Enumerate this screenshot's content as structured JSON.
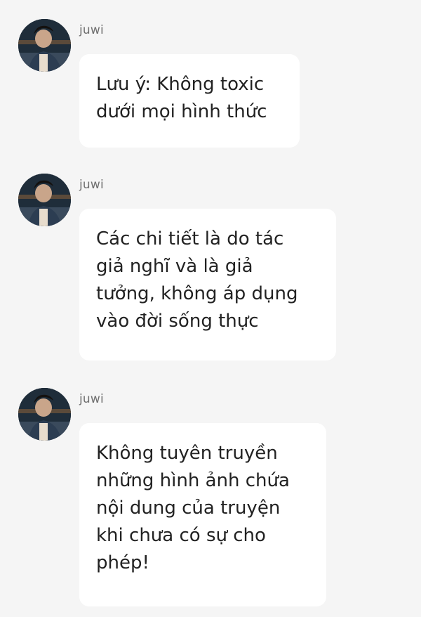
{
  "messages": [
    {
      "author": "juwi",
      "avatar_icon": "user-avatar-photo",
      "lines": [
        "Lưu ý: Không toxic",
        "dưới mọi hình thức"
      ]
    },
    {
      "author": "juwi",
      "avatar_icon": "user-avatar-photo",
      "lines": [
        "Các chi tiết là do tác",
        "giả nghĩ và là giả",
        "tưởng, không áp dụng",
        "vào đời sống thực"
      ]
    },
    {
      "author": "juwi",
      "avatar_icon": "user-avatar-photo",
      "lines": [
        "Không tuyên truyền",
        "những hình ảnh chứa",
        "nội dung của truyện",
        "khi chưa có sự cho",
        "phép!"
      ]
    }
  ],
  "colors": {
    "background": "#f5f5f5",
    "bubble": "#ffffff",
    "text": "#222222",
    "username": "#6f6f6f"
  }
}
